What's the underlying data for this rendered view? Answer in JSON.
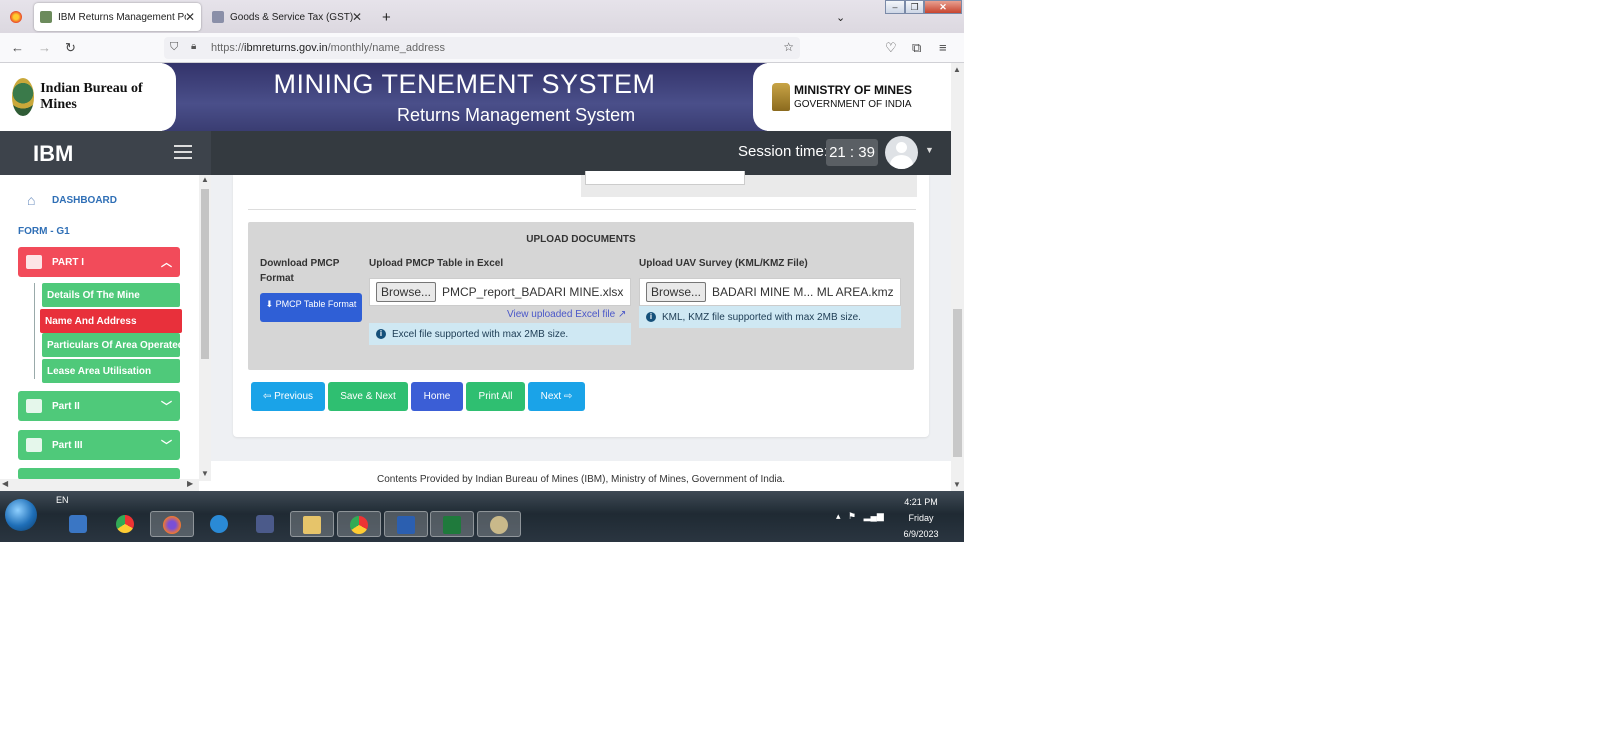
{
  "browser": {
    "tabs": [
      {
        "label": "IBM Returns Management Port",
        "active": true
      },
      {
        "label": "Goods & Service Tax (GST) | Us",
        "active": false
      }
    ],
    "new_tab": "+",
    "url_prefix": "https://",
    "url_host": "ibmreturns.gov.in",
    "url_path": "/monthly/name_address"
  },
  "header": {
    "left_logo_text": "Indian Bureau of Mines",
    "title": "MINING TENEMENT SYSTEM",
    "subtitle": "Returns Management System",
    "ministry_line1": "MINISTRY OF MINES",
    "ministry_line2": "GOVERNMENT OF INDIA"
  },
  "topnav": {
    "brand": "IBM",
    "session_label": "Session time:",
    "session_value": "21 : 39"
  },
  "sidebar": {
    "dashboard": "DASHBOARD",
    "form": "FORM - G1",
    "part1": "PART I",
    "part1_items": [
      {
        "label": "Details Of The Mine",
        "active": false
      },
      {
        "label": "Name And Address",
        "active": true
      },
      {
        "label": "Particulars Of Area Operated",
        "active": false
      },
      {
        "label": "Lease Area Utilisation",
        "active": false
      }
    ],
    "part2": "Part II",
    "part3": "Part III"
  },
  "upload": {
    "heading": "UPLOAD DOCUMENTS",
    "download_label": "Download PMCP Format",
    "download_button": "PMCP Table Format",
    "excel_label": "Upload PMCP Table in Excel",
    "excel_browse": "Browse...",
    "excel_file": "PMCP_report_BADARI MINE.xlsx",
    "excel_view_link": "View uploaded Excel file",
    "excel_info": "Excel file supported with max 2MB size.",
    "uav_label": "Upload UAV Survey (KML/KMZ File)",
    "uav_browse": "Browse...",
    "uav_file": "BADARI MINE M... ML AREA.kmz",
    "uav_info": "KML, KMZ file supported with max 2MB size."
  },
  "actions": {
    "previous": "Previous",
    "save_next": "Save & Next",
    "home": "Home",
    "print_all": "Print All",
    "next": "Next"
  },
  "footer": "Contents Provided by Indian Bureau of Mines (IBM), Ministry of Mines, Government of India.",
  "taskbar": {
    "lang": "EN",
    "time": "4:21 PM",
    "day": "Friday",
    "date": "6/9/2023"
  },
  "colors": {
    "banner": "#3a3d72",
    "topnav": "#343a40",
    "part_red": "#f24b5a",
    "part_green": "#4fc97a",
    "btn_blue": "#1aa3e8",
    "btn_green": "#2fbf71",
    "btn_home": "#3b5ed6"
  }
}
